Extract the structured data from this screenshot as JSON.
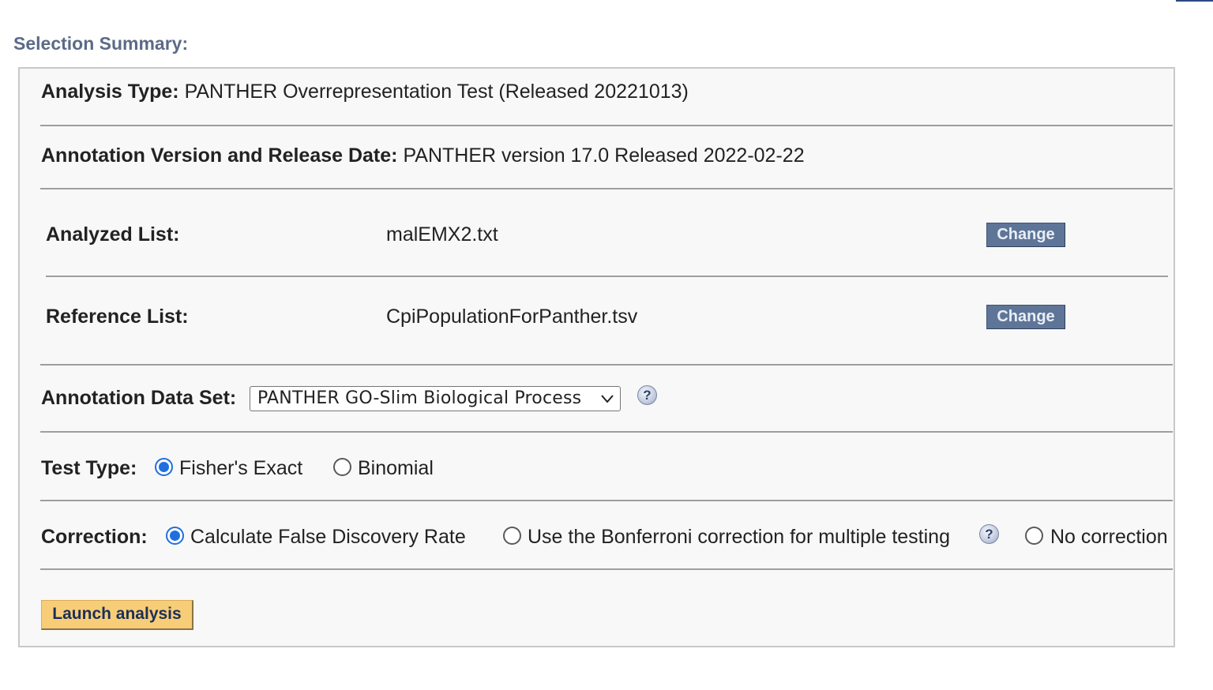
{
  "heading": "Selection Summary:",
  "analysis_type": {
    "label": "Analysis Type:",
    "value": "PANTHER Overrepresentation Test (Released 20221013)"
  },
  "annotation_version": {
    "label": "Annotation Version and Release Date:",
    "value": "PANTHER version 17.0 Released 2022-02-22"
  },
  "analyzed_list": {
    "label": "Analyzed List:",
    "value": "malEMX2.txt",
    "button": "Change"
  },
  "reference_list": {
    "label": "Reference List:",
    "value": "CpiPopulationForPanther.tsv",
    "button": "Change"
  },
  "annotation_data_set": {
    "label": "Annotation Data Set:",
    "selected": "PANTHER GO-Slim Biological Process",
    "help": "?"
  },
  "test_type": {
    "label": "Test Type:",
    "options": [
      {
        "label": "Fisher's Exact",
        "checked": true
      },
      {
        "label": "Binomial",
        "checked": false
      }
    ]
  },
  "correction": {
    "label": "Correction:",
    "options": [
      {
        "label": "Calculate False Discovery Rate",
        "checked": true
      },
      {
        "label": "Use the Bonferroni correction for multiple testing",
        "checked": false
      },
      {
        "label": "No correction",
        "checked": false
      }
    ],
    "help": "?"
  },
  "launch_button": "Launch analysis",
  "colors": {
    "heading": "#5b6b86",
    "change_button": "#5e7598",
    "launch_button": "#f7cd78",
    "radio_selected": "#1f6fe0"
  }
}
